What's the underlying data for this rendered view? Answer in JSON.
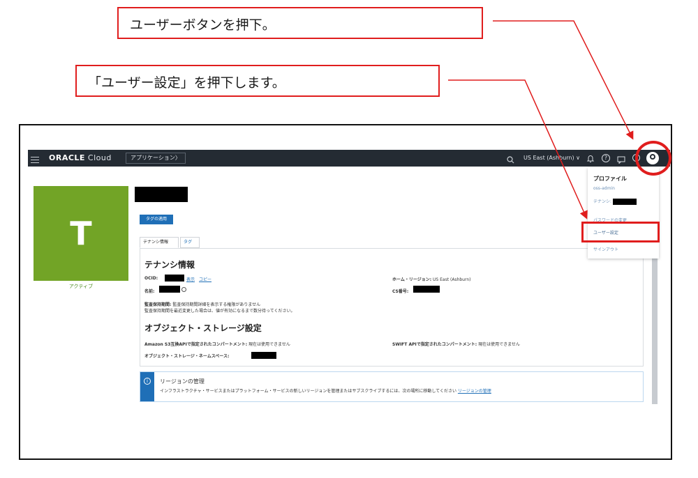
{
  "callouts": {
    "user_button": "ユーザーボタンを押下。",
    "user_settings": "「ユーザー設定」を押下します。"
  },
  "topbar": {
    "brand_bold": "ORACLE",
    "brand_rest": " Cloud",
    "applications_button": "アプリケーション〉",
    "region": "US East (Ashburn) ∨",
    "help_glyph": "?"
  },
  "tenancy": {
    "avatar_letter": "T",
    "status": "アクティブ",
    "apply_tags_button": "タグの適用",
    "tabs": [
      "テナンシ情報",
      "タグ"
    ],
    "section_tenancy": "テナンシ情報",
    "ocid_label": "OCID:",
    "ocid_show": "表示",
    "ocid_copy": "コピー",
    "home_region_label": "ホーム・リージョン:",
    "home_region_value": "US East (Ashburn)",
    "name_label": "名前:",
    "cs_label": "CS番号:",
    "audit_label": "監査保持期間:",
    "audit_value": "監査保持期間詳細を表示する権限がありません",
    "audit_note": "監査保持期間を最近変更した場合は、値が有効になるまで数分待ってください。",
    "section_storage": "オブジェクト・ストレージ設定",
    "s3_label": "Amazon S3互換APIで指定されたコンパートメント:",
    "s3_value": "現在は使用できません",
    "swift_label": "SWIFT APIで指定されたコンパートメント:",
    "swift_value": "現在は使用できません",
    "namespace_label": "オブジェクト・ストレージ・ネームスペース:"
  },
  "notice": {
    "icon": "i",
    "title": "リージョンの管理",
    "text": "インフラストラクチャ・サービスまたはプラットフォーム・サービスの新しいリージョンを管理またはサブスクライブするには、次の場所に移動してください",
    "link": "リージョンの管理"
  },
  "menu": {
    "profile": "プロファイル",
    "user": "oss-admin",
    "tenancy": "テナンシ:",
    "password": "パスワードの変更",
    "user_settings": "ユーザー設定",
    "sign_out": "サインアウト"
  },
  "colors": {
    "callout_border": "#e01d1d",
    "topbar": "#242b33",
    "avatar": "#72a426",
    "accent_blue": "#1f6fb7"
  }
}
